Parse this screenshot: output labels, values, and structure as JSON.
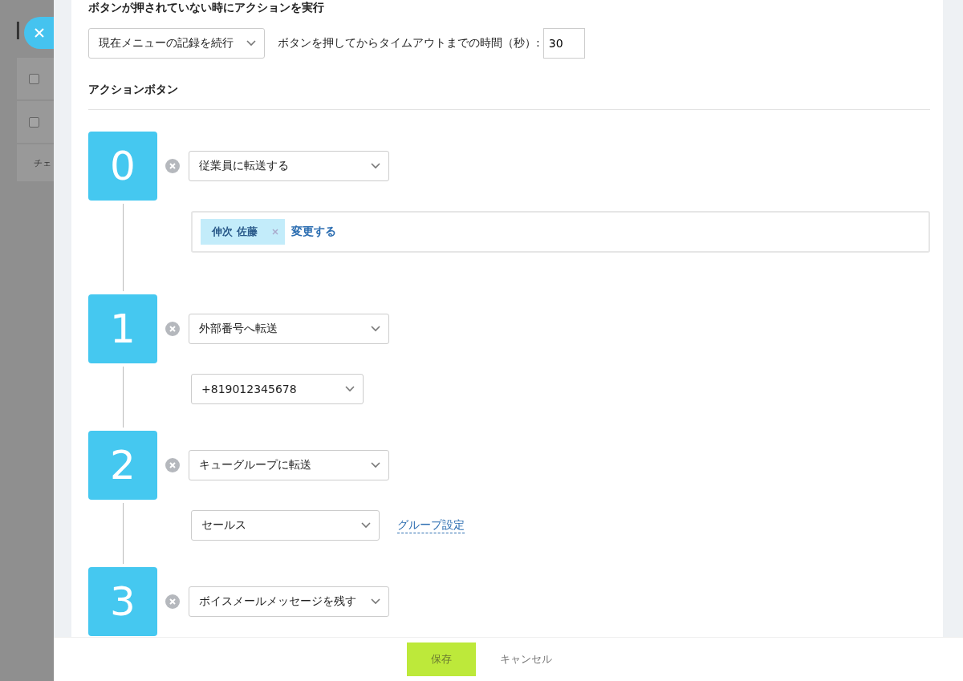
{
  "background": {
    "heading": "I",
    "rows": [
      {
        "checked": false
      },
      {
        "checked": false
      }
    ],
    "row_label": "チェ"
  },
  "no_press": {
    "title": "ボタンが押されていない時にアクションを実行",
    "action": "現在メニューの記録を続行",
    "timeout_label": "ボタンを押してからタイムアウトまでの時間（秒）:",
    "timeout_value": "30"
  },
  "action_buttons": {
    "title": "アクションボタン",
    "steps": [
      {
        "number": "0",
        "action": "従業員に転送する",
        "detail": {
          "kind": "employee",
          "tag": "伸次 佐藤",
          "link": "変更する"
        }
      },
      {
        "number": "1",
        "action": "外部番号へ転送",
        "detail": {
          "kind": "phone",
          "value": "+819012345678"
        }
      },
      {
        "number": "2",
        "action": "キューグループに転送",
        "detail": {
          "kind": "queue",
          "value": "セールス",
          "link": "グループ設定"
        }
      },
      {
        "number": "3",
        "action": "ボイスメールメッセージを残す"
      }
    ]
  },
  "footer": {
    "save": "保存",
    "cancel": "キャンセル"
  }
}
